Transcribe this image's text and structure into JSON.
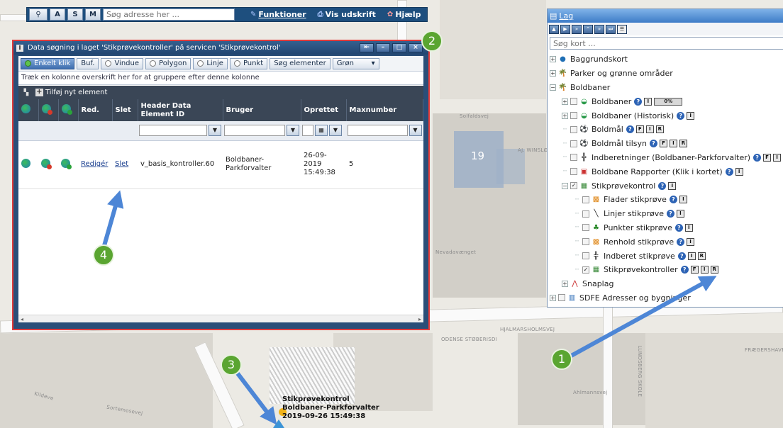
{
  "toolbar": {
    "btn_a": "A",
    "btn_s": "S",
    "btn_m": "M",
    "search_placeholder": "Søg adresse her ...",
    "funktioner": "Funktioner",
    "vis_udskrift": "Vis udskrift",
    "hjaelp": "Hjælp"
  },
  "data_window": {
    "title": "Data søgning i laget 'Stikprøvekontroller' på servicen 'Stikprøvekontrol'",
    "filters": [
      "Enkelt klik",
      "Buf.",
      "Vindue",
      "Polygon",
      "Linje",
      "Punkt",
      "Søg elementer",
      "Grøn"
    ],
    "group_hint": "Træk en kolonne overskrift her for at gruppere efter denne kolonne",
    "add_new": "Tilføj nyt element",
    "columns": [
      "Red.",
      "Slet",
      "Header Data Element ID",
      "Bruger",
      "Oprettet",
      "Maxnumber"
    ],
    "row": {
      "edit": "Redigér",
      "delete": "Slet",
      "id": "v_basis_kontroller.60",
      "user": "Boldbaner-Parkforvalter",
      "created": "26-09-2019 15:49:38",
      "maxnumber": "5"
    }
  },
  "layer_panel": {
    "title": "Lag",
    "search_placeholder": "Søg kort ...",
    "items": [
      {
        "label": "Baggrundskort"
      },
      {
        "label": "Parker og grønne områder"
      },
      {
        "label": "Boldbaner"
      },
      {
        "label": "Boldbaner",
        "pct": "0%"
      },
      {
        "label": "Boldbaner (Historisk)"
      },
      {
        "label": "Boldmål"
      },
      {
        "label": "Boldmål tilsyn"
      },
      {
        "label": "Indberetninger (Boldbaner-Parkforvalter)"
      },
      {
        "label": "Boldbane Rapporter (Klik i kortet)"
      },
      {
        "label": "Stikprøvekontrol"
      },
      {
        "label": "Flader stikprøve"
      },
      {
        "label": "Linjer stikprøve"
      },
      {
        "label": "Punkter stikprøve"
      },
      {
        "label": "Renhold stikprøve"
      },
      {
        "label": "Indberet stikprøve"
      },
      {
        "label": "Stikprøvekontroller"
      },
      {
        "label": "Snaplag"
      },
      {
        "label": "SDFE Adresser og bygninger"
      }
    ]
  },
  "map": {
    "label_19": "19",
    "popup_line1": "Stikprøvekontrol",
    "popup_line2": "Boldbaner-Parkforvalter",
    "popup_line3": "2019-09-26 15:49:38",
    "street_labels": [
      "Solfaldsvej",
      "Nevadavænget",
      "AJ. WINSLØV",
      "HJALMARSHOLMSVEJ",
      "ODENSE STØBERISDI",
      "Ahlmannsvej",
      "LUNDSBERG SKOLE",
      "Sortemosevej",
      "Kildeve",
      "FRÆGERSHAVE"
    ]
  },
  "callouts": [
    "1",
    "2",
    "3",
    "4"
  ]
}
